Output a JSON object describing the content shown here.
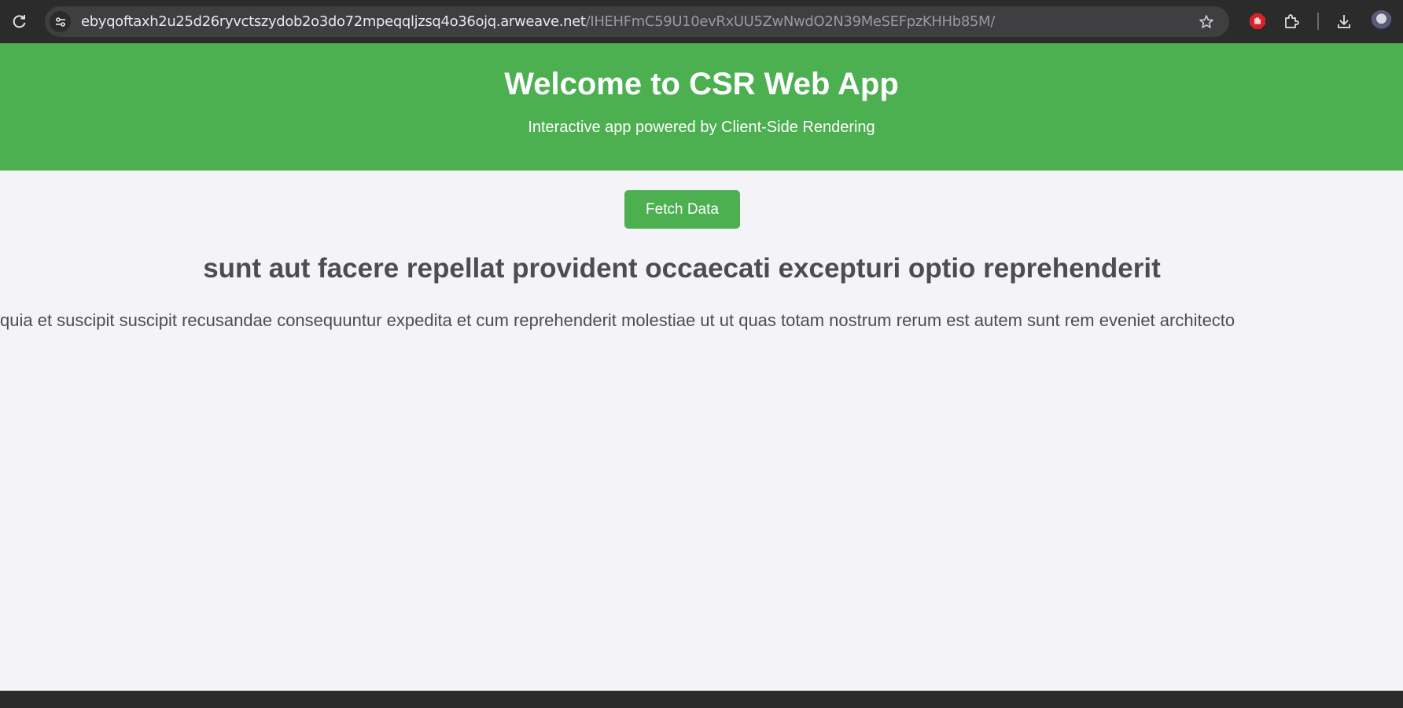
{
  "browser": {
    "url_host": "ebyqoftaxh2u25d26ryvctszydob2o3do72mpeqqljzsq4o36ojq.arweave.net",
    "url_path": "/IHEHFmC59U10evRxUU5ZwNwdO2N39MeSEFpzKHHb85M/",
    "icons": [
      "reload-icon",
      "site-info-icon",
      "bookmark-star-icon",
      "extension-stop-icon",
      "extensions-puzzle-icon",
      "download-icon",
      "profile-avatar"
    ]
  },
  "header": {
    "title": "Welcome to CSR Web App",
    "subtitle": "Interactive app powered by Client-Side Rendering",
    "background_color": "#4caf50"
  },
  "main": {
    "fetch_button_label": "Fetch Data",
    "post_title": "sunt aut facere repellat provident occaecati excepturi optio reprehenderit",
    "post_body": "quia et suscipit suscipit recusandae consequuntur expedita et cum reprehenderit molestiae ut ut quas totam nostrum rerum est autem sunt rem eveniet architecto"
  }
}
